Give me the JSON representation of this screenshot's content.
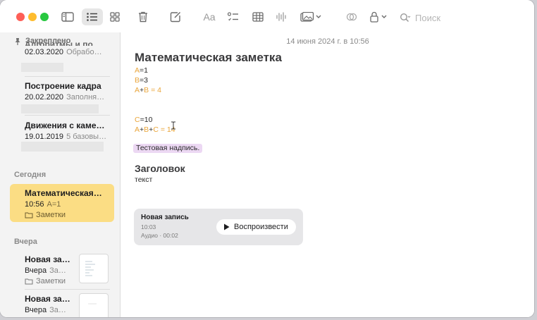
{
  "colors": {
    "accent_yellow": "#e9a53a",
    "selected_bg": "#fbdd84",
    "highlight_bg": "#ecd8f3",
    "close": "#fe5f57",
    "minimize": "#febc2e",
    "zoom": "#28c840"
  },
  "toolbar": {
    "buttons": [
      "sidebar-toggle-icon",
      "list-view-icon",
      "gallery-view-icon",
      "trash-icon",
      "compose-icon",
      "format-text-icon",
      "checklist-icon",
      "table-icon",
      "audio-icon",
      "media-icon",
      "collaborate-icon",
      "lock-icon"
    ],
    "format_label": "Aa",
    "search_placeholder": "Поиск"
  },
  "sidebar": {
    "pinned_label": "Закреплено",
    "pinned_notes": [
      {
        "title": "Алгоритмы и по…",
        "date": "02.03.2020",
        "preview": "Обрабо…"
      },
      {
        "title": "Построение кадра",
        "date": "20.02.2020",
        "preview": "Заполня…"
      },
      {
        "title": "Движения с каме…",
        "date": "19.01.2019",
        "preview": "5 базовы…"
      }
    ],
    "today_label": "Сегодня",
    "today_notes": [
      {
        "title": "Математическая…",
        "time": "10:56",
        "preview": "A=1",
        "folder": "Заметки"
      }
    ],
    "yesterday_label": "Вчера",
    "yesterday_notes": [
      {
        "title": "Новая за…",
        "date": "Вчера",
        "preview": "За…",
        "folder": "Заметки"
      },
      {
        "title": "Новая за…",
        "date": "Вчера",
        "preview": "За…"
      }
    ]
  },
  "note": {
    "date_header": "14 июня 2024 г. в 10:56",
    "title": "Математическая заметка",
    "lines": {
      "a_var": "A",
      "a_val": "=1",
      "b_var": "B",
      "b_val": "=3",
      "sum1_a": "A",
      "sum1_plus": "+",
      "sum1_b": "B",
      "sum1_result": " = 4",
      "c_var": "C",
      "c_val": "=10",
      "sum2_a": "A",
      "sum2_plus1": "+",
      "sum2_b": "B",
      "sum2_plus2": "+",
      "sum2_c": "C",
      "sum2_result": " = 14"
    },
    "highlighted_text": "Тестовая надпись.",
    "heading": "Заголовок",
    "body": "текст",
    "audio": {
      "title": "Новая запись",
      "time": "10:03",
      "meta": "Аудио · 00:02",
      "play_label": "Воспроизвести"
    }
  }
}
